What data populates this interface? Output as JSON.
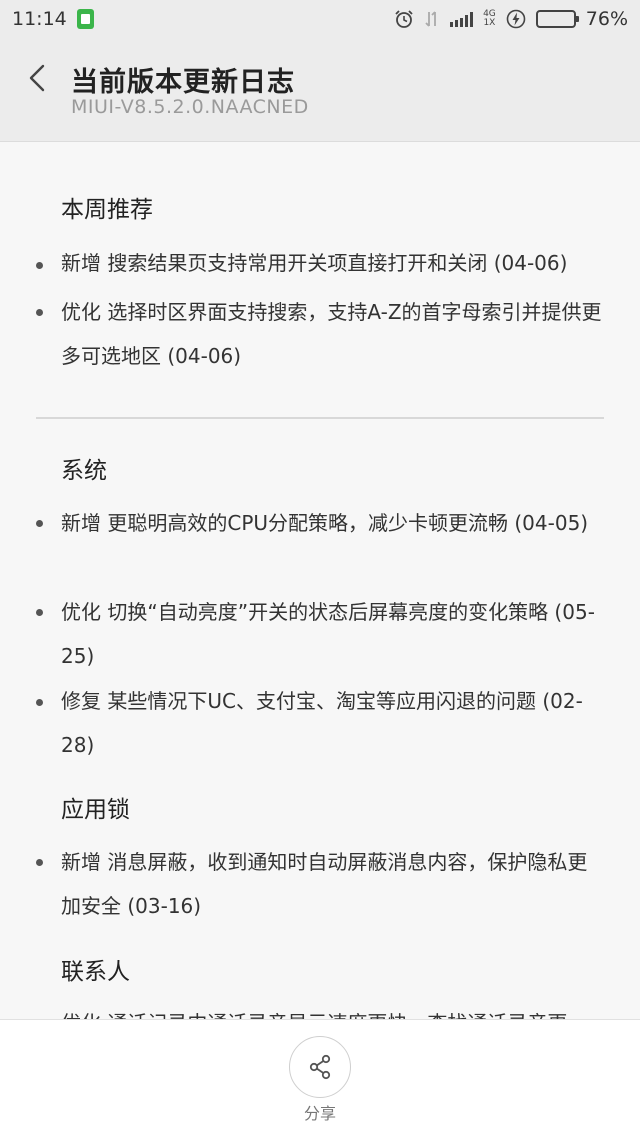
{
  "status_bar": {
    "time": "11:14",
    "network_top": "4G",
    "network_bottom": "1X",
    "battery_percent": "76%"
  },
  "header": {
    "title": "当前版本更新日志",
    "subtitle": "MIUI-V8.5.2.0.NAACNED"
  },
  "sections": [
    {
      "title": "本周推荐",
      "items": [
        "新增 搜索结果页支持常用开关项直接打开和关闭 (04-06)",
        "优化 选择时区界面支持搜索，支持A-Z的首字母索引并提供更多可选地区 (04-06)"
      ]
    },
    {
      "title": "系统",
      "items": [
        "新增 更聪明高效的CPU分配策略，减少卡顿更流畅 (04-05)",
        "优化 切换“自动亮度”开关的状态后屏幕亮度的变化策略 (05-25)",
        "修复 某些情况下UC、支付宝、淘宝等应用闪退的问题 (02-28)"
      ]
    },
    {
      "title": "应用锁",
      "items": [
        "新增 消息屏蔽，收到通知时自动屏蔽消息内容，保护隐私更加安全 (03-16)"
      ]
    },
    {
      "title": "联系人",
      "items": [
        "优化 通话记录中通话录音显示速度更快，查找通话录音更"
      ]
    }
  ],
  "bottom_bar": {
    "share_label": "分享"
  },
  "colors": {
    "battery_green": "#3bb54a",
    "header_bg": "#ececec",
    "content_bg": "#f7f7f7"
  }
}
